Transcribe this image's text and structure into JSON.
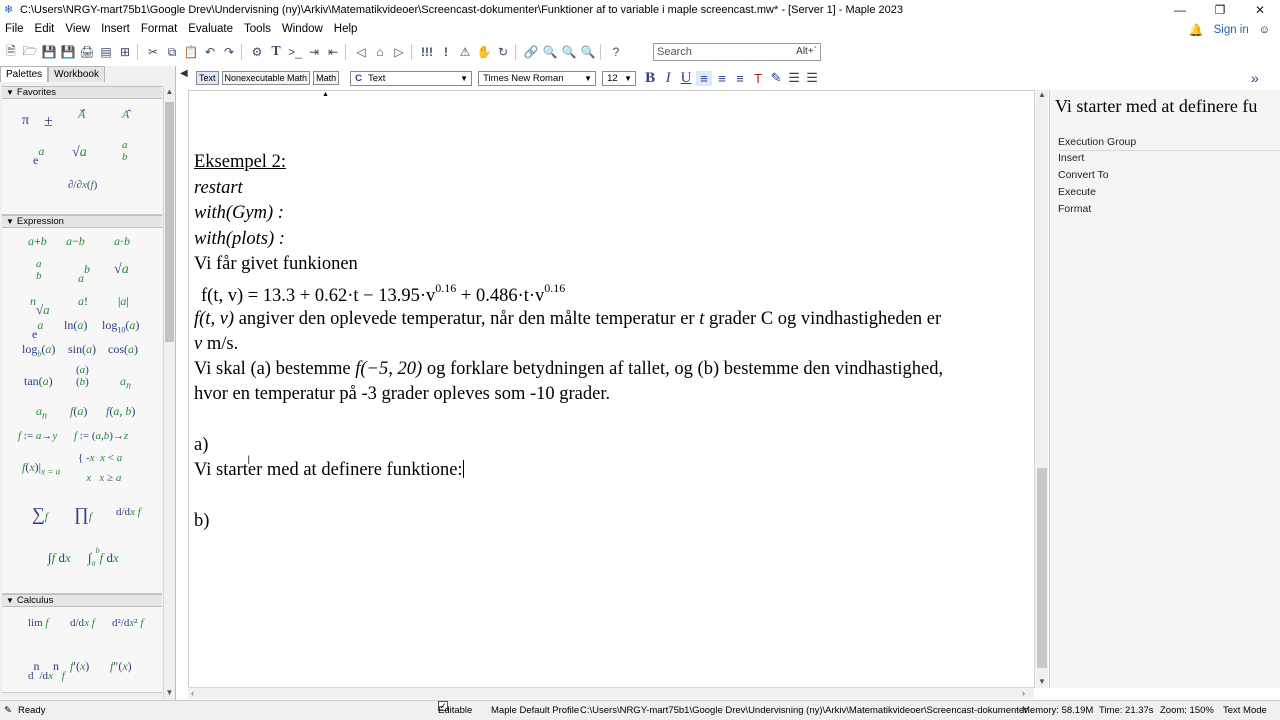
{
  "window": {
    "title": "C:\\Users\\NRGY-mart75b1\\Google Drev\\Undervisning (ny)\\Arkiv\\Matematikvideoer\\Screencast-dokumenter\\Funktioner af to variable i maple screencast.mw* - [Server 1] - Maple 2023",
    "controls": [
      "—",
      "❐",
      "✕"
    ]
  },
  "menu": {
    "items": [
      "File",
      "Edit",
      "View",
      "Insert",
      "Format",
      "Evaluate",
      "Tools",
      "Window",
      "Help"
    ],
    "sign_in": "Sign in"
  },
  "toolbar": {
    "search_placeholder": "Search",
    "search_hint": "Alt+`"
  },
  "palette": {
    "tabs": [
      "Palettes",
      "Workbook"
    ],
    "sections": {
      "favorites": "Favorites",
      "expression": "Expression",
      "calculus": "Calculus"
    }
  },
  "format_bar": {
    "mode_buttons": [
      "Text",
      "Nonexecutable Math",
      "Math"
    ],
    "style": "Text",
    "style_prefix": "C",
    "font": "Times New Roman",
    "size": "12"
  },
  "document": {
    "heading": "Eksempel 2:",
    "cmd_restart": "restart",
    "cmd_gym": "with(Gym) :",
    "cmd_plots": "with(plots) :",
    "intro": "Vi får givet funkionen",
    "equation_lhs": "f(t, v) = 13.3 + 0.62·t − 13.95·v",
    "equation_exp1": "0.16",
    "equation_mid": " + 0.486·t·v",
    "equation_exp2": "0.16",
    "desc_fn": "f(t, v)",
    "desc_text_a": " angiver den oplevede temperatur, når den målte temperatur er ",
    "desc_t": "t",
    "desc_text_b": " grader C og vindhastigheden er",
    "desc_v": "v",
    "desc_unit": " m/s.",
    "task_a": "Vi skal (a) bestemme ",
    "task_fn": "f(−5, 20)",
    "task_b": " og forklare betydningen af tallet, og (b) bestemme den vindhastighed,",
    "task_line2": "hvor en temperatur på -3 grader opleves som -10 grader.",
    "part_a": "a)",
    "part_a_text": "Vi starter med at definere funktione:",
    "part_b": "b)"
  },
  "context_panel": {
    "title": "Vi starter med at definere fu",
    "items": [
      "Execution Group",
      "Insert",
      "Convert To",
      "Execute",
      "Format"
    ]
  },
  "status": {
    "ready": "Ready",
    "editable": "Editable",
    "profile": "Maple Default Profile",
    "path": "C:\\Users\\NRGY-mart75b1\\Google Drev\\Undervisning (ny)\\Arkiv\\Matematikvideoer\\Screencast-dokumenter",
    "memory": "Memory: 58.19M",
    "time": "Time: 21.37s",
    "zoom": "Zoom: 150%",
    "mode": "Text Mode"
  }
}
